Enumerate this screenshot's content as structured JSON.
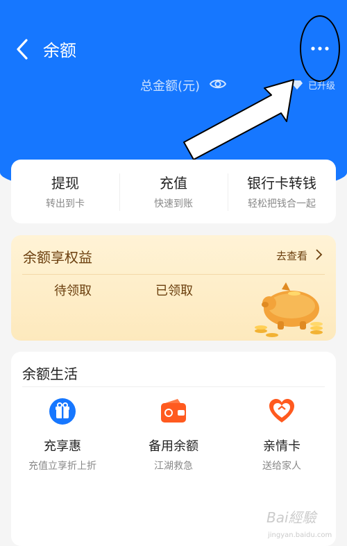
{
  "header": {
    "title": "余额",
    "total_label": "总金额(元)",
    "badge_text": "已升级"
  },
  "actions": [
    {
      "label": "提现",
      "sub": "转出到卡"
    },
    {
      "label": "充值",
      "sub": "快速到账"
    },
    {
      "label": "银行卡转钱",
      "sub": "轻松把钱合一起"
    }
  ],
  "benefit": {
    "title": "余额享权益",
    "link": "去查看",
    "tabs": [
      "待领取",
      "已领取"
    ]
  },
  "life": {
    "title": "余额生活",
    "items": [
      {
        "label": "充享惠",
        "sub": "充值立享折上折",
        "icon": "gift-icon"
      },
      {
        "label": "备用余额",
        "sub": "江湖救急",
        "icon": "wallet-icon"
      },
      {
        "label": "亲情卡",
        "sub": "送给家人",
        "icon": "heart-card-icon"
      }
    ]
  },
  "watermark": {
    "text": "Bai經驗",
    "sub": "jingyan.baidu.com"
  },
  "colors": {
    "brand": "#1677ff",
    "benefit_text": "#6b3f0e",
    "life_icon": "#1677ff",
    "wallet_icon": "#ff5a1f"
  }
}
